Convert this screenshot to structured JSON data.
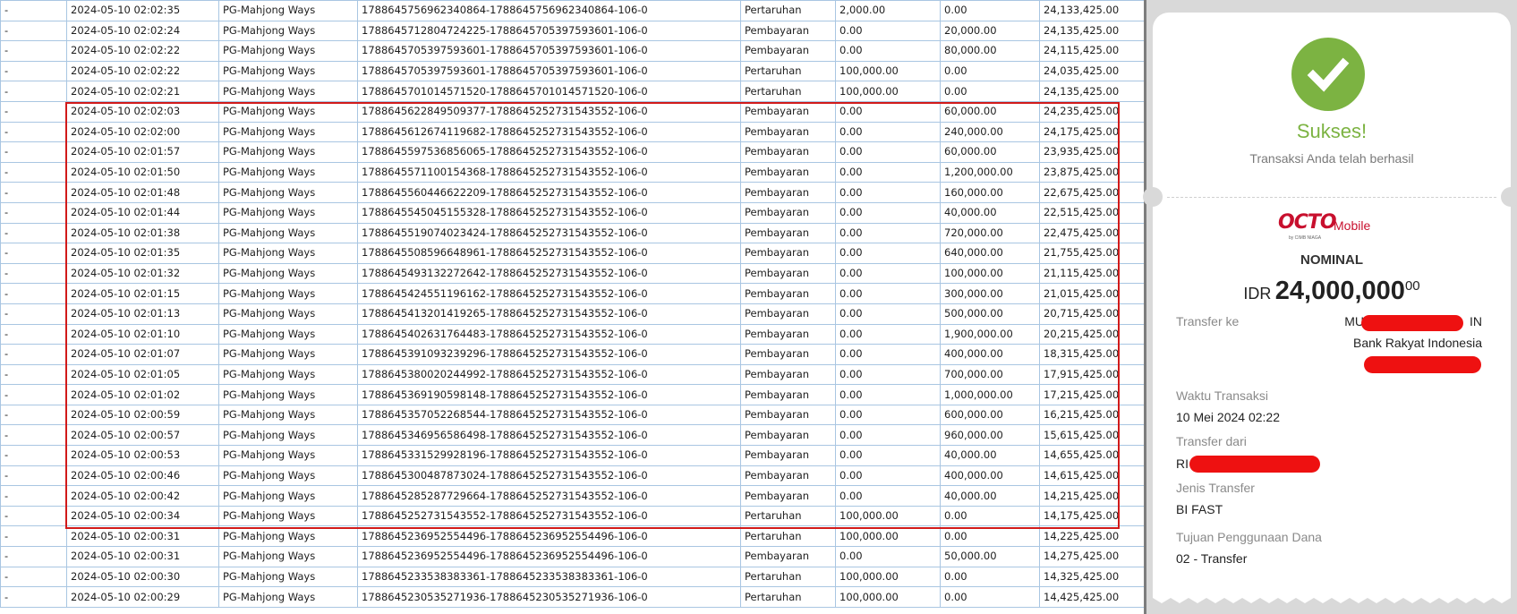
{
  "rows": [
    [
      "-",
      "2024-05-10 02:02:35",
      "PG-Mahjong Ways",
      "1788645756962340864-1788645756962340864-106-0",
      "Pertaruhan",
      "2,000.00",
      "0.00",
      "24,133,425.00"
    ],
    [
      "-",
      "2024-05-10 02:02:24",
      "PG-Mahjong Ways",
      "1788645712804724225-1788645705397593601-106-0",
      "Pembayaran",
      "0.00",
      "20,000.00",
      "24,135,425.00"
    ],
    [
      "-",
      "2024-05-10 02:02:22",
      "PG-Mahjong Ways",
      "1788645705397593601-1788645705397593601-106-0",
      "Pembayaran",
      "0.00",
      "80,000.00",
      "24,115,425.00"
    ],
    [
      "-",
      "2024-05-10 02:02:22",
      "PG-Mahjong Ways",
      "1788645705397593601-1788645705397593601-106-0",
      "Pertaruhan",
      "100,000.00",
      "0.00",
      "24,035,425.00"
    ],
    [
      "-",
      "2024-05-10 02:02:21",
      "PG-Mahjong Ways",
      "1788645701014571520-1788645701014571520-106-0",
      "Pertaruhan",
      "100,000.00",
      "0.00",
      "24,135,425.00"
    ],
    [
      "-",
      "2024-05-10 02:02:03",
      "PG-Mahjong Ways",
      "1788645622849509377-1788645252731543552-106-0",
      "Pembayaran",
      "0.00",
      "60,000.00",
      "24,235,425.00"
    ],
    [
      "-",
      "2024-05-10 02:02:00",
      "PG-Mahjong Ways",
      "1788645612674119682-1788645252731543552-106-0",
      "Pembayaran",
      "0.00",
      "240,000.00",
      "24,175,425.00"
    ],
    [
      "-",
      "2024-05-10 02:01:57",
      "PG-Mahjong Ways",
      "1788645597536856065-1788645252731543552-106-0",
      "Pembayaran",
      "0.00",
      "60,000.00",
      "23,935,425.00"
    ],
    [
      "-",
      "2024-05-10 02:01:50",
      "PG-Mahjong Ways",
      "1788645571100154368-1788645252731543552-106-0",
      "Pembayaran",
      "0.00",
      "1,200,000.00",
      "23,875,425.00"
    ],
    [
      "-",
      "2024-05-10 02:01:48",
      "PG-Mahjong Ways",
      "1788645560446622209-1788645252731543552-106-0",
      "Pembayaran",
      "0.00",
      "160,000.00",
      "22,675,425.00"
    ],
    [
      "-",
      "2024-05-10 02:01:44",
      "PG-Mahjong Ways",
      "1788645545045155328-1788645252731543552-106-0",
      "Pembayaran",
      "0.00",
      "40,000.00",
      "22,515,425.00"
    ],
    [
      "-",
      "2024-05-10 02:01:38",
      "PG-Mahjong Ways",
      "1788645519074023424-1788645252731543552-106-0",
      "Pembayaran",
      "0.00",
      "720,000.00",
      "22,475,425.00"
    ],
    [
      "-",
      "2024-05-10 02:01:35",
      "PG-Mahjong Ways",
      "1788645508596648961-1788645252731543552-106-0",
      "Pembayaran",
      "0.00",
      "640,000.00",
      "21,755,425.00"
    ],
    [
      "-",
      "2024-05-10 02:01:32",
      "PG-Mahjong Ways",
      "1788645493132272642-1788645252731543552-106-0",
      "Pembayaran",
      "0.00",
      "100,000.00",
      "21,115,425.00"
    ],
    [
      "-",
      "2024-05-10 02:01:15",
      "PG-Mahjong Ways",
      "1788645424551196162-1788645252731543552-106-0",
      "Pembayaran",
      "0.00",
      "300,000.00",
      "21,015,425.00"
    ],
    [
      "-",
      "2024-05-10 02:01:13",
      "PG-Mahjong Ways",
      "1788645413201419265-1788645252731543552-106-0",
      "Pembayaran",
      "0.00",
      "500,000.00",
      "20,715,425.00"
    ],
    [
      "-",
      "2024-05-10 02:01:10",
      "PG-Mahjong Ways",
      "1788645402631764483-1788645252731543552-106-0",
      "Pembayaran",
      "0.00",
      "1,900,000.00",
      "20,215,425.00"
    ],
    [
      "-",
      "2024-05-10 02:01:07",
      "PG-Mahjong Ways",
      "1788645391093239296-1788645252731543552-106-0",
      "Pembayaran",
      "0.00",
      "400,000.00",
      "18,315,425.00"
    ],
    [
      "-",
      "2024-05-10 02:01:05",
      "PG-Mahjong Ways",
      "1788645380020244992-1788645252731543552-106-0",
      "Pembayaran",
      "0.00",
      "700,000.00",
      "17,915,425.00"
    ],
    [
      "-",
      "2024-05-10 02:01:02",
      "PG-Mahjong Ways",
      "1788645369190598148-1788645252731543552-106-0",
      "Pembayaran",
      "0.00",
      "1,000,000.00",
      "17,215,425.00"
    ],
    [
      "-",
      "2024-05-10 02:00:59",
      "PG-Mahjong Ways",
      "1788645357052268544-1788645252731543552-106-0",
      "Pembayaran",
      "0.00",
      "600,000.00",
      "16,215,425.00"
    ],
    [
      "-",
      "2024-05-10 02:00:57",
      "PG-Mahjong Ways",
      "1788645346956586498-1788645252731543552-106-0",
      "Pembayaran",
      "0.00",
      "960,000.00",
      "15,615,425.00"
    ],
    [
      "-",
      "2024-05-10 02:00:53",
      "PG-Mahjong Ways",
      "1788645331529928196-1788645252731543552-106-0",
      "Pembayaran",
      "0.00",
      "40,000.00",
      "14,655,425.00"
    ],
    [
      "-",
      "2024-05-10 02:00:46",
      "PG-Mahjong Ways",
      "1788645300487873024-1788645252731543552-106-0",
      "Pembayaran",
      "0.00",
      "400,000.00",
      "14,615,425.00"
    ],
    [
      "-",
      "2024-05-10 02:00:42",
      "PG-Mahjong Ways",
      "1788645285287729664-1788645252731543552-106-0",
      "Pembayaran",
      "0.00",
      "40,000.00",
      "14,215,425.00"
    ],
    [
      "-",
      "2024-05-10 02:00:34",
      "PG-Mahjong Ways",
      "1788645252731543552-1788645252731543552-106-0",
      "Pertaruhan",
      "100,000.00",
      "0.00",
      "14,175,425.00"
    ],
    [
      "-",
      "2024-05-10 02:00:31",
      "PG-Mahjong Ways",
      "1788645236952554496-1788645236952554496-106-0",
      "Pertaruhan",
      "100,000.00",
      "0.00",
      "14,225,425.00"
    ],
    [
      "-",
      "2024-05-10 02:00:31",
      "PG-Mahjong Ways",
      "1788645236952554496-1788645236952554496-106-0",
      "Pembayaran",
      "0.00",
      "50,000.00",
      "14,275,425.00"
    ],
    [
      "-",
      "2024-05-10 02:00:30",
      "PG-Mahjong Ways",
      "1788645233538383361-1788645233538383361-106-0",
      "Pertaruhan",
      "100,000.00",
      "0.00",
      "14,325,425.00"
    ],
    [
      "-",
      "2024-05-10 02:00:29",
      "PG-Mahjong Ways",
      "1788645230535271936-1788645230535271936-106-0",
      "Pertaruhan",
      "100,000.00",
      "0.00",
      "14,425,425.00"
    ]
  ],
  "colors": {
    "highlight": "#d11a1a",
    "success_green": "#7cb342",
    "redaction": "#ee1111",
    "brand_red": "#c8102e",
    "grid_line": "#a9c6e2"
  },
  "receipt": {
    "status_icon": "checkmark-icon",
    "title": "Sukses!",
    "subtitle": "Transaksi Anda telah berhasil",
    "logo": {
      "brand": "OCTO",
      "product": "Mobile",
      "byline": "by CIMB NIAGA"
    },
    "nominal_label": "NOMINAL",
    "currency": "IDR",
    "amount": "24,000,000",
    "cents": "00",
    "transfer_to_label": "Transfer ke",
    "recipient_prefix": "MU",
    "recipient_suffix": "IN",
    "bank": "Bank Rakyat Indonesia",
    "time_label": "Waktu Transaksi",
    "time_value": "10 Mei 2024 02:22",
    "from_label": "Transfer dari",
    "from_prefix": "RI",
    "type_label": "Jenis Transfer",
    "type_value": "BI FAST",
    "purpose_label": "Tujuan Penggunaan Dana",
    "purpose_value": "02 - Transfer"
  }
}
